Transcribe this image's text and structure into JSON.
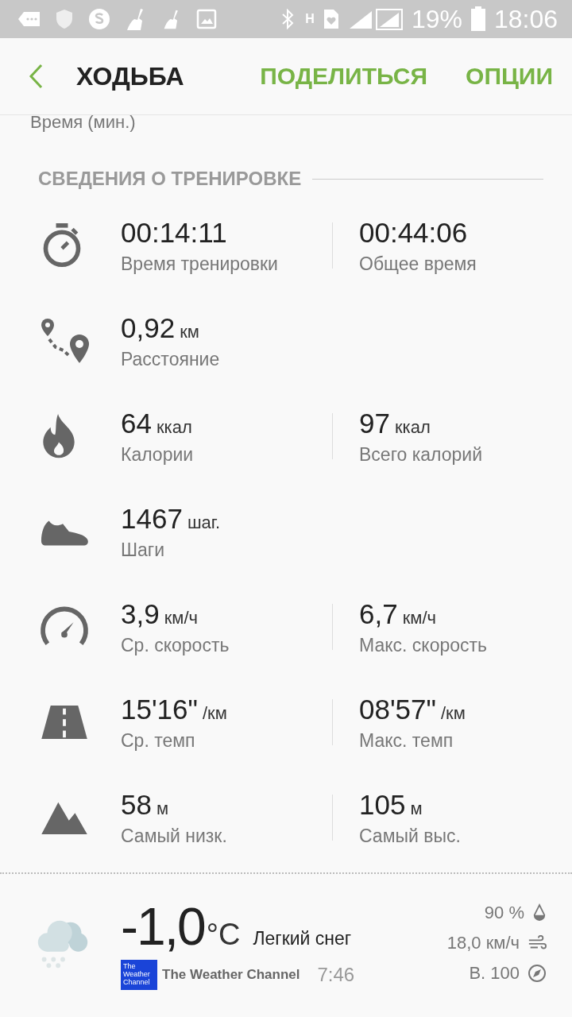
{
  "status_bar": {
    "network_letter": "H",
    "battery": "19%",
    "time": "18:06"
  },
  "header": {
    "title": "ХОДЬБА",
    "actions": [
      "ПОДЕЛИТЬСЯ",
      "ОПЦИИ"
    ]
  },
  "chart_axis_label": "Время (мин.)",
  "section_title": "СВЕДЕНИЯ О ТРЕНИРОВКЕ",
  "stats": [
    {
      "kind": "timer",
      "cells": [
        {
          "value": "00:14:11",
          "label": "Время тренировки"
        },
        {
          "value": "00:44:06",
          "label": "Общее время"
        }
      ]
    },
    {
      "kind": "route",
      "cells": [
        {
          "value": "0,92",
          "unit": "км",
          "label": "Расстояние"
        }
      ]
    },
    {
      "kind": "flame",
      "cells": [
        {
          "value": "64",
          "unit": "ккал",
          "label": "Калории"
        },
        {
          "value": "97",
          "unit": "ккал",
          "label": "Всего калорий"
        }
      ]
    },
    {
      "kind": "shoe",
      "cells": [
        {
          "value": "1467",
          "unit": "шаг.",
          "label": "Шаги"
        }
      ]
    },
    {
      "kind": "speed",
      "cells": [
        {
          "value": "3,9",
          "unit": "км/ч",
          "label": "Ср. скорость"
        },
        {
          "value": "6,7",
          "unit": "км/ч",
          "label": "Макс. скорость"
        }
      ]
    },
    {
      "kind": "road",
      "cells": [
        {
          "value": "15'16\"",
          "unit": "/км",
          "label": "Ср. темп"
        },
        {
          "value": "08'57\"",
          "unit": "/км",
          "label": "Макс. темп"
        }
      ]
    },
    {
      "kind": "mountain",
      "cells": [
        {
          "value": "58",
          "unit": "м",
          "label": "Самый низк."
        },
        {
          "value": "105",
          "unit": "м",
          "label": "Самый выс."
        }
      ]
    }
  ],
  "weather": {
    "temperature": "-1,0",
    "degree_unit": "°C",
    "condition": "Легкий снег",
    "provider_logo_text": "The Weather Channel",
    "provider": "The Weather Channel",
    "updated": "7:46",
    "humidity": "90 %",
    "wind": "18,0 км/ч",
    "direction": "В. 100"
  }
}
